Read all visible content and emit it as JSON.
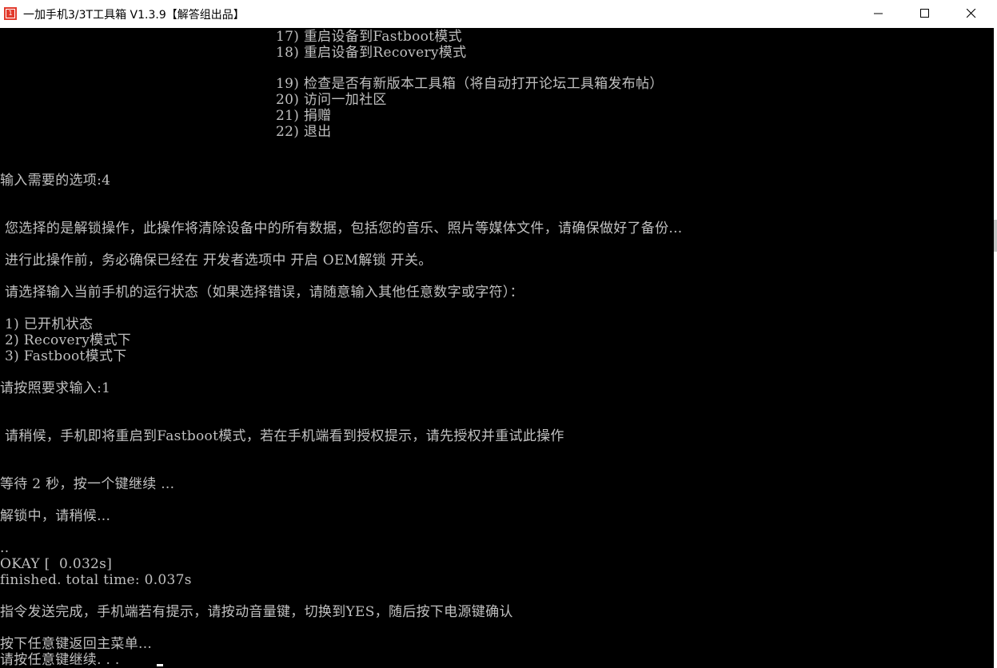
{
  "window": {
    "icon_glyph": "1",
    "title": "一加手机3/3T工具箱 V1.3.9【解答组出品】",
    "controls": [
      "minimize-icon",
      "maximize-icon",
      "close-icon"
    ]
  },
  "console": {
    "lines": [
      "17) 重启设备到Fastboot模式",
      "18) 重启设备到Recovery模式",
      "19) 检查是否有新版本工具箱（将自动打开论坛工具箱发布帖）",
      "20) 访问一加社区",
      "21) 捐赠",
      "22) 退出",
      "输入需要的选项:4",
      "您选择的是解锁操作，此操作将清除设备中的所有数据，包括您的音乐、照片等媒体文件，请确保做好了备份...",
      "进行此操作前，务必确保已经在 开发者选项中 开启 OEM解锁 开关。",
      "请选择输入当前手机的运行状态（如果选择错误，请随意输入其他任意数字或字符）：",
      "1) 已开机状态",
      "2) Recovery模式下",
      "3) Fastboot模式下",
      "请按照要求输入:1",
      "请稍候，手机即将重启到Fastboot模式，若在手机端看到授权提示，请先授权并重试此操作",
      "等待 2 秒，按一个键继续 ...",
      "解锁中，请稍候...",
      "..",
      "OKAY [  0.032s]",
      "finished. total time: 0.037s",
      "指令发送完成，手机端若有提示，请按动音量键，切换到YES，随后按下电源键确认",
      "按下任意键返回主菜单...",
      "请按任意键继续. . ."
    ]
  }
}
